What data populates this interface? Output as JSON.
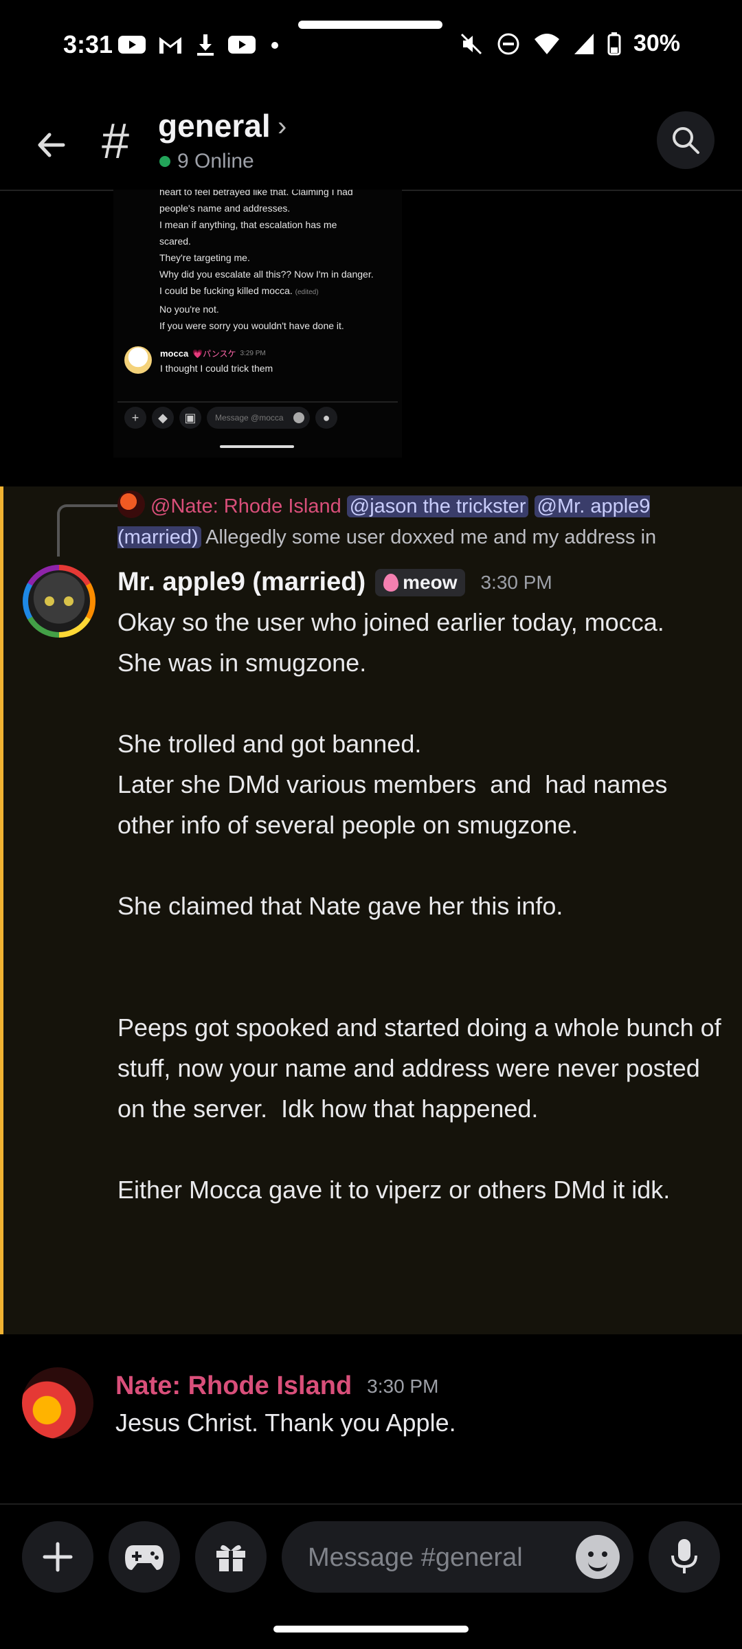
{
  "status_bar": {
    "time": "3:31",
    "battery": "30%",
    "icons": [
      "youtube-icon",
      "gmail-icon",
      "download-icon",
      "youtube-icon",
      "dot-icon",
      "mute-icon",
      "dnd-icon",
      "wifi-icon",
      "signal-icon",
      "battery-icon"
    ]
  },
  "header": {
    "channel_name": "general",
    "online_count": "9 Online"
  },
  "embed": {
    "lines": [
      "heart to feel betrayed like that. Claiming I had",
      "people's name and addresses.",
      "I mean if anything, that escalation has me",
      "scared.",
      "They're targeting me.",
      "Why did you escalate all this?? Now I'm in danger.",
      "I could be fucking killed mocca.",
      "No you're not.",
      "If you were sorry you wouldn't have done it."
    ],
    "edited_label": "(edited)",
    "user": "mocca",
    "user_tag": "💗パンスケ",
    "time": "3:29 PM",
    "message": "I thought I could trick them",
    "composer_placeholder": "Message @mocca"
  },
  "reply": {
    "author": "@Nate: Rhode Island",
    "mention1": "@jason the trickster",
    "mention2": "@Mr. apple9 (married)",
    "text": " Allegedly some user doxxed me and my address in"
  },
  "message1": {
    "author": "Mr. apple9 (married)",
    "tag": "meow",
    "time": "3:30 PM",
    "body": "Okay so the user who joined earlier today, mocca.\nShe was in smugzone.\n\nShe trolled and got banned.\nLater she DMd various members  and  had names other info of several people on smugzone.\n\nShe claimed that Nate gave her this info.\n\n\nPeeps got spooked and started doing a whole bunch of stuff, now your name and address were never posted on the server.  Idk how that happened.\n\nEither Mocca gave it to viperz or others DMd it idk."
  },
  "message2": {
    "author": "Nate: Rhode Island",
    "time": "3:30 PM",
    "body": "Jesus Christ. Thank you Apple."
  },
  "composer": {
    "placeholder": "Message #general"
  },
  "colors": {
    "highlight_bg": "#15130b",
    "highlight_bar": "#f0b232",
    "author_pink": "#d94f7a",
    "online_green": "#23a55a",
    "mention_bg": "#3a3d6a"
  }
}
